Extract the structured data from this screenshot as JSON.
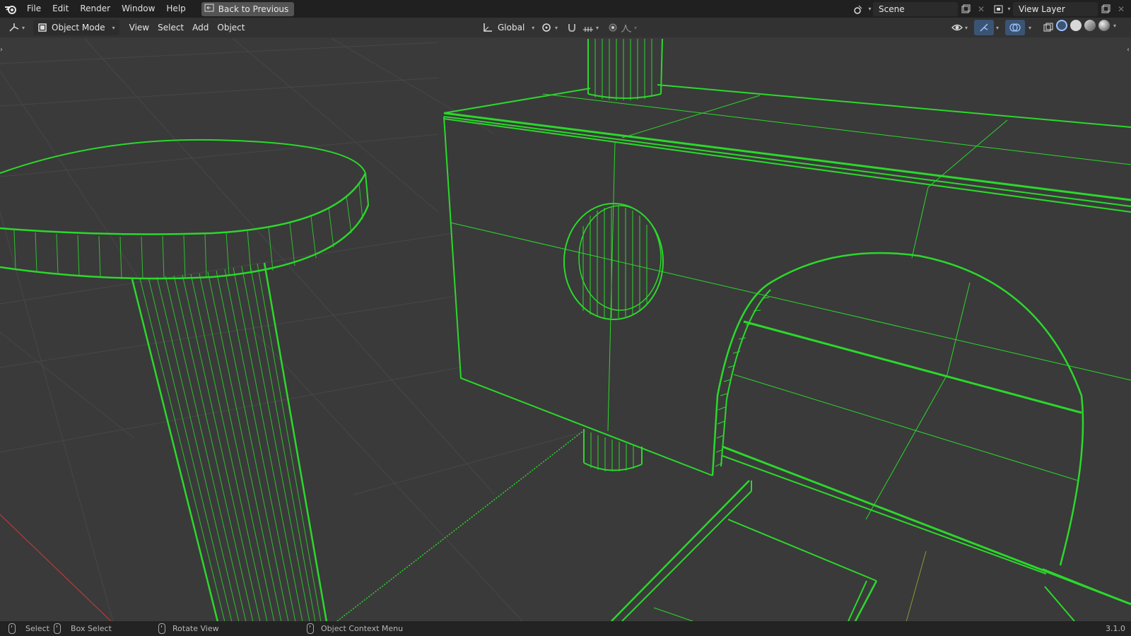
{
  "topbar": {
    "menus": [
      "File",
      "Edit",
      "Render",
      "Window",
      "Help"
    ],
    "back_button": "Back to Previous",
    "scene_label": "Scene",
    "view_layer_label": "View Layer"
  },
  "header": {
    "mode": "Object Mode",
    "menus": [
      "View",
      "Select",
      "Add",
      "Object"
    ],
    "transform_orientation": "Global"
  },
  "status": {
    "select": "Select",
    "box_select": "Box Select",
    "rotate_view": "Rotate View",
    "context_menu": "Object Context Menu",
    "version": "3.1.0"
  },
  "colors": {
    "wire": "#2bd82b",
    "background": "#3a3a3a",
    "grid": "#4a4a4a",
    "x_axis": "#c23a3a"
  }
}
